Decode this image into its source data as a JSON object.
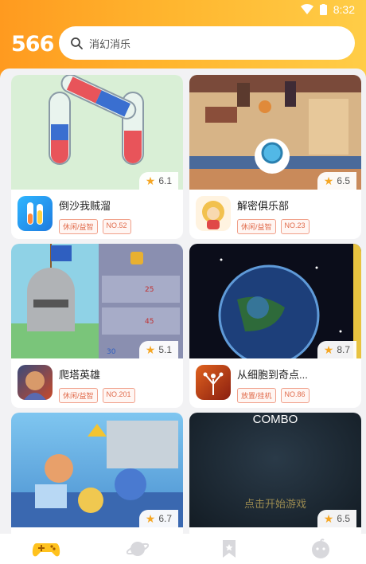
{
  "status": {
    "time": "8:32"
  },
  "header": {
    "logo": "566",
    "search_placeholder": "消幻消乐"
  },
  "games": [
    {
      "name": "倒沙我贼溜",
      "rating": "6.1",
      "tags": [
        "休闲/益智",
        "NO.52"
      ]
    },
    {
      "name": "解密俱乐部",
      "rating": "6.5",
      "tags": [
        "休闲/益智",
        "NO.23"
      ]
    },
    {
      "name": "爬塔英雄",
      "rating": "5.1",
      "tags": [
        "休闲/益智",
        "NO.201"
      ]
    },
    {
      "name": "从细胞到奇点...",
      "rating": "8.7",
      "tags": [
        "放置/挂机",
        "NO.86"
      ]
    },
    {
      "name": "",
      "rating": "6.7",
      "tags": []
    },
    {
      "name": "",
      "rating": "6.5",
      "tags": [],
      "thumb_title": "COMBO",
      "thumb_subtitle": "点击开始游戏"
    }
  ],
  "colors": {
    "accent": "#ffa726",
    "tag": "#e06a4a",
    "star": "#f5a623"
  }
}
